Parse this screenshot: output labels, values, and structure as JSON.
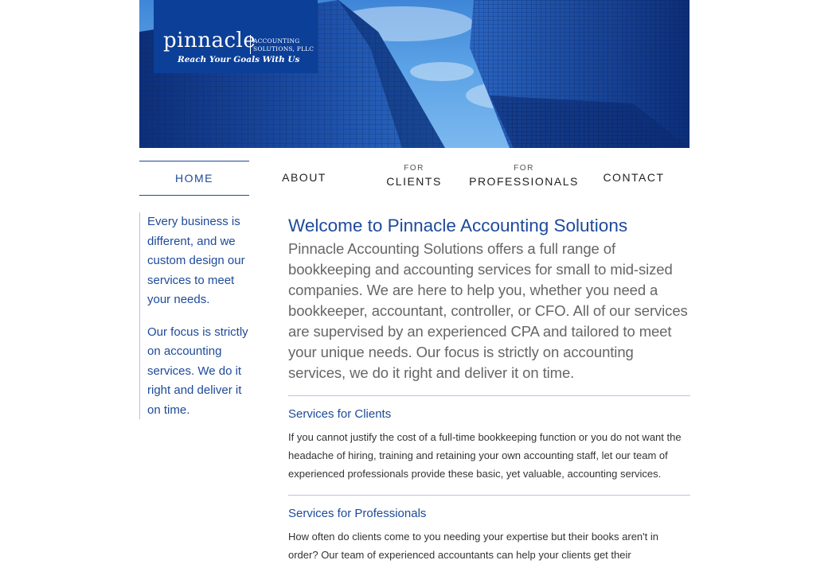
{
  "brand": {
    "name": "pinnacle",
    "line1": "ACCOUNTING",
    "line2": "SOLUTIONS, PLLC",
    "tagline": "Reach Your Goals With Us"
  },
  "nav": {
    "home": "HOME",
    "about": "ABOUT",
    "clients_prefix": "FOR",
    "clients": "CLIENTS",
    "professionals_prefix": "FOR",
    "professionals": "PROFESSIONALS",
    "contact": "CONTACT"
  },
  "sidebar": {
    "p1": "Every business is different, and we custom design our services to meet your needs.",
    "p2": "Our focus is strictly on accounting services. We do it right and deliver it on time."
  },
  "main": {
    "title": "Welcome to Pinnacle Accounting Solutions",
    "intro": "Pinnacle Accounting Solutions offers a full range of bookkeeping and accounting services for small to mid-sized companies. We are here to help you, whether you need a bookkeeper, accountant, controller, or CFO. All of our services are supervised by an experienced CPA and tailored to meet your unique needs. Our focus is strictly on accounting services, we do it right and deliver it on time.",
    "sections": [
      {
        "title": "Services for Clients",
        "body": "If you cannot justify the cost of a full-time bookkeeping function or you do not want the headache of hiring, training and retaining your own accounting staff, let our team of experienced professionals provide these basic, yet valuable, accounting services."
      },
      {
        "title": "Services for Professionals",
        "body": "How often do clients come to you needing your expertise but their books aren't in order? Our team of experienced accountants can help your clients get their"
      }
    ]
  },
  "colors": {
    "brand_blue": "#1d4a9a",
    "logo_bg": "#0b3f98",
    "rule": "#b9c5df"
  }
}
